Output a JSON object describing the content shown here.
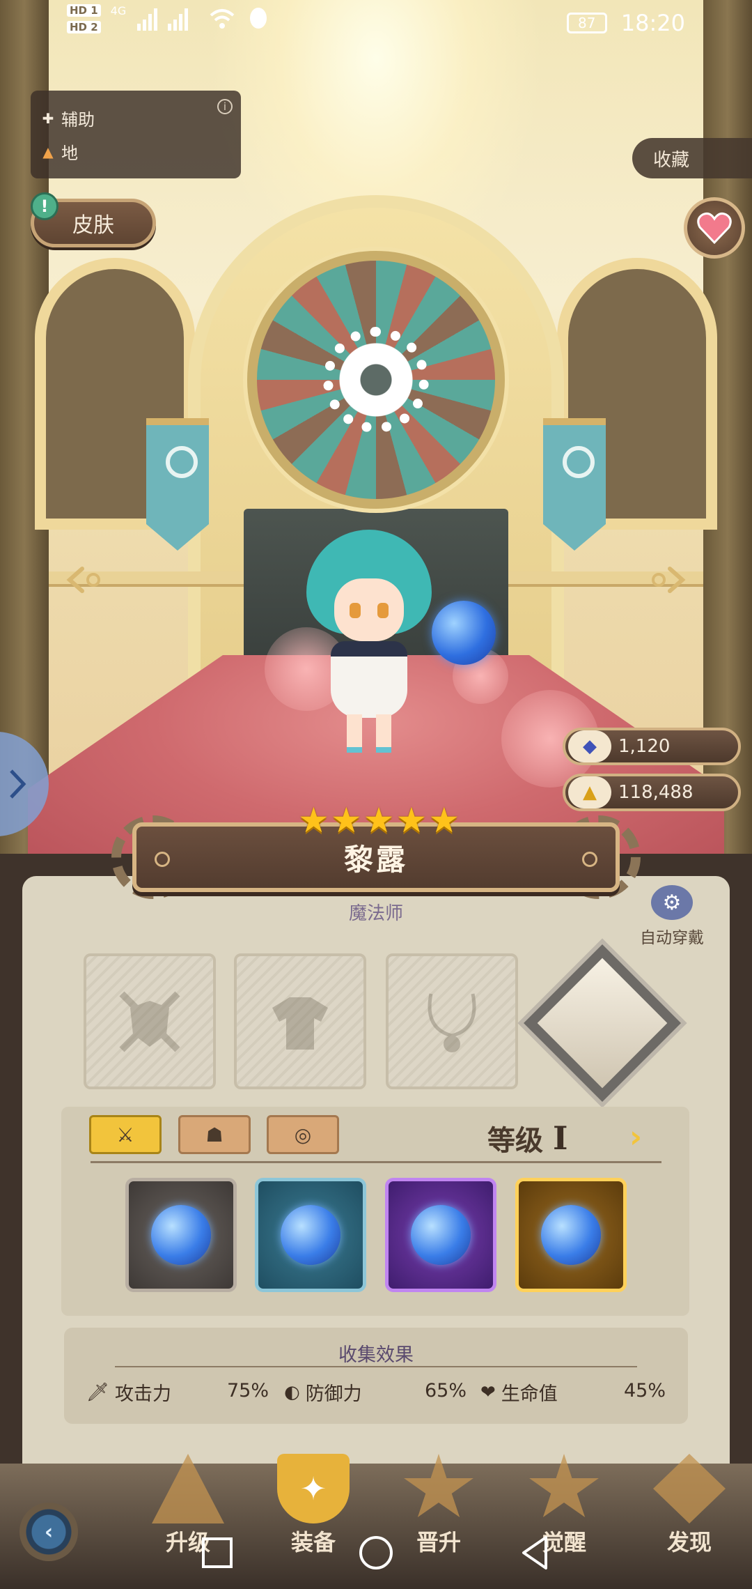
{
  "status_bar": {
    "sim1": "HD 1",
    "sim2": "HD 2",
    "network": "4G",
    "battery": "87",
    "time": "18:20"
  },
  "hero": {
    "role_label": "辅助",
    "element_label": "地",
    "name": "黎露",
    "class": "魔法师",
    "stars": 5
  },
  "buttons": {
    "skin": "皮肤",
    "collect": "收藏",
    "auto_equip": "自动穿戴"
  },
  "currency": {
    "gems": "1,120",
    "gold": "118,488"
  },
  "equipment": {
    "level_label": "等级",
    "level_value": "I",
    "tabs": [
      "weapon",
      "armor",
      "accessory"
    ],
    "selected_tab": 0
  },
  "collection": {
    "title": "收集效果",
    "stats": [
      {
        "label": "攻击力",
        "value": "75%"
      },
      {
        "label": "防御力",
        "value": "65%"
      },
      {
        "label": "生命值",
        "value": "45%"
      }
    ]
  },
  "bottom_nav": {
    "items": [
      "升级",
      "装备",
      "晋升",
      "觉醒",
      "发现"
    ],
    "active": 1
  },
  "colors": {
    "accent": "#f2c43c",
    "panel": "#dcd5c1",
    "plate": "#5e4433"
  }
}
